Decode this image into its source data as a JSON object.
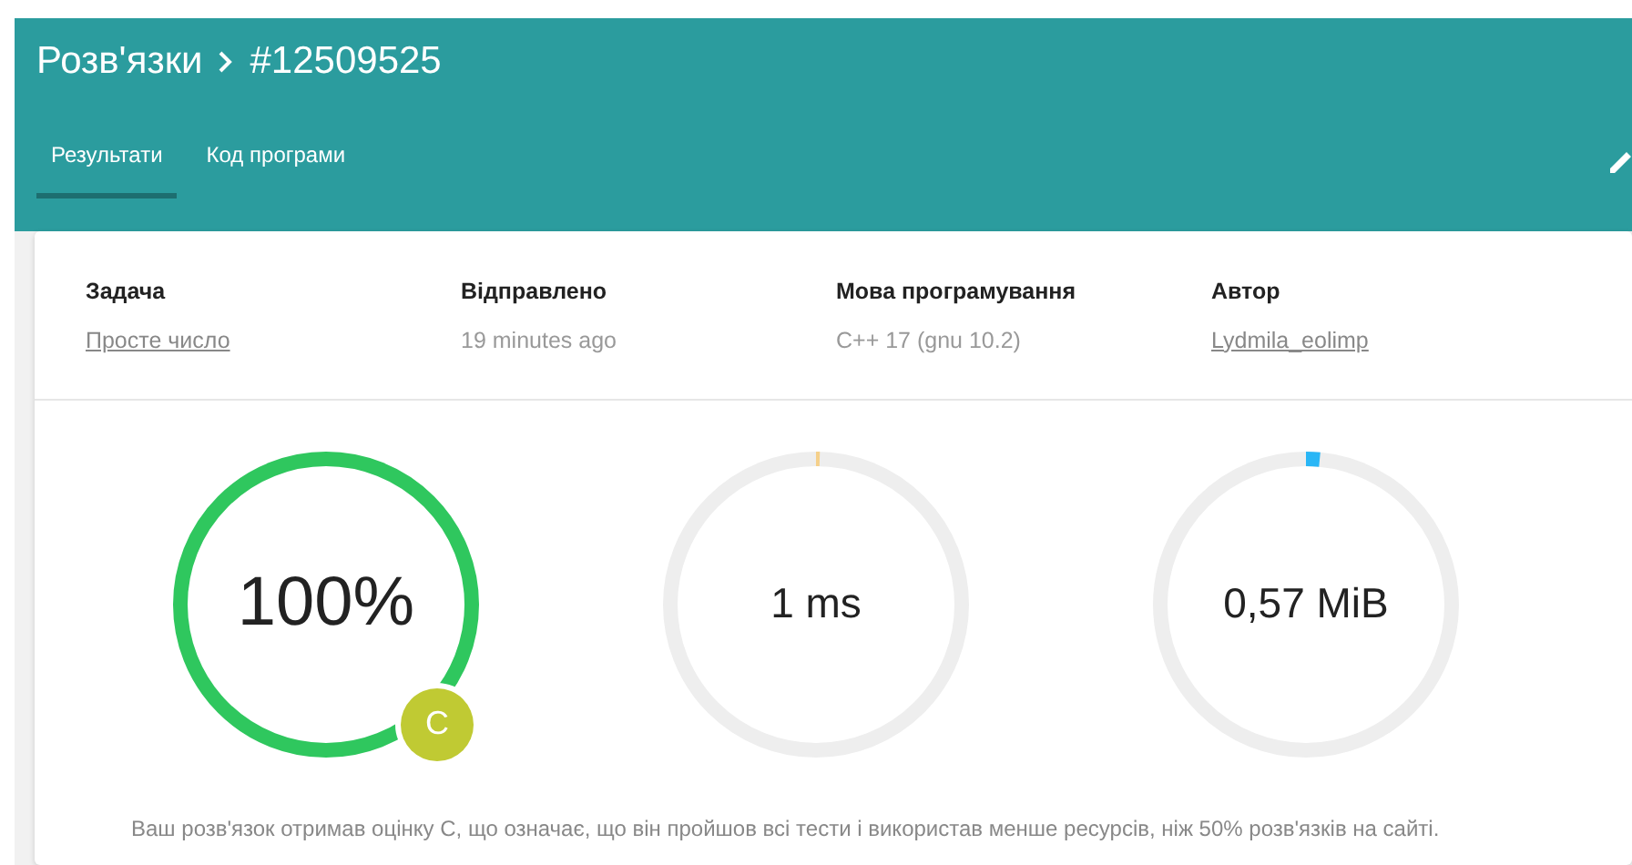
{
  "header": {
    "section": "Розв'язки",
    "submission": "#12509525"
  },
  "tabs": [
    {
      "label": "Результати",
      "selected": true
    },
    {
      "label": "Код програми",
      "selected": false
    }
  ],
  "info": [
    {
      "label": "Задача",
      "value": "Просте число",
      "kind": "link"
    },
    {
      "label": "Відправлено",
      "value": "19 minutes ago",
      "kind": "text"
    },
    {
      "label": "Мова програмування",
      "value": "C++ 17 (gnu 10.2)",
      "kind": "text"
    },
    {
      "label": "Автор",
      "value": "Lydmila_eolimp",
      "kind": "link"
    }
  ],
  "gauges": [
    {
      "value": "100%",
      "color": "#2fc75e",
      "kind": "score",
      "grade": {
        "letter": "C",
        "color": "#c0ca33"
      }
    },
    {
      "value": "1 ms",
      "color": "#f5d08a",
      "kind": "time"
    },
    {
      "value": "0,57 MiB",
      "color": "#29b6f6",
      "kind": "memory"
    }
  ],
  "message": "Ваш розв'язок отримав оцінку C, що означає, що він пройшов всі тести і використав менше ресурсів, ніж 50% розв'язків на сайті."
}
